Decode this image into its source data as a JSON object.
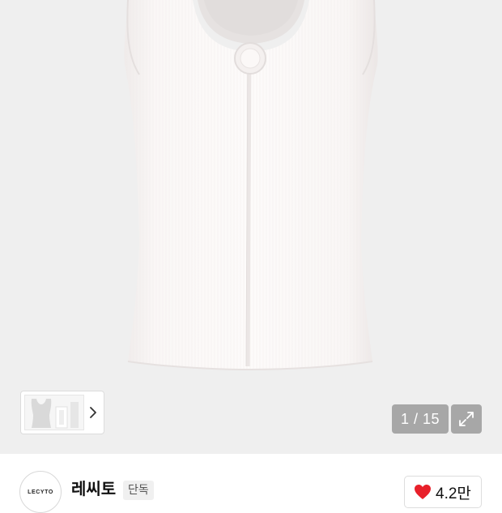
{
  "gallery": {
    "image_alt": "Ribbed white sleeveless top with round o-ring detail",
    "thumbnail_alt": "Product thumbnails",
    "current_index": "1",
    "separator": " / ",
    "total": "15",
    "expand_icon": "expand-arrows-icon",
    "next_icon": "chevron-right-icon"
  },
  "brand": {
    "logo_text": "LECYTO",
    "name": "레씨토",
    "badge": "단독"
  },
  "like": {
    "icon": "heart-icon",
    "color": "#e8202a",
    "count": "4.2만"
  },
  "colors": {
    "gallery_bg": "#efefef",
    "garment": "#fbf8f7"
  }
}
